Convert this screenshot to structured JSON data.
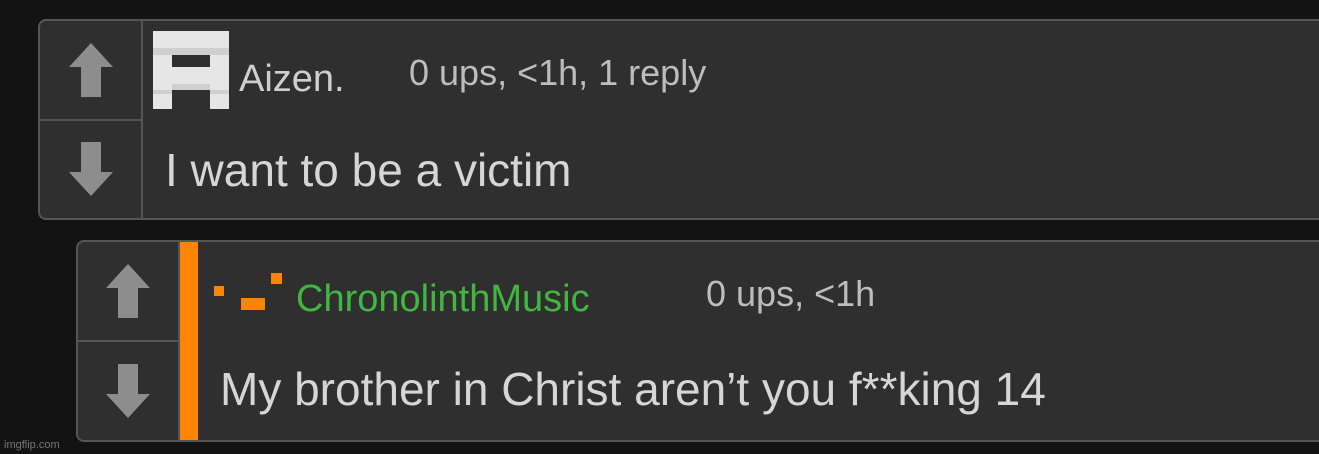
{
  "comments": [
    {
      "username": "Aizen.",
      "meta": "0 ups, <1h, 1 reply",
      "text": "I want to be a victim",
      "username_color": "#cfcfcf",
      "avatar": "white-pixel-avatar"
    },
    {
      "username": "ChronolinthMusic",
      "meta": "0 ups, <1h",
      "text": "My brother in Christ aren’t you f**king 14",
      "username_color": "#42b740",
      "avatar": "orange-pixel-avatar",
      "highlight_color": "#ff8400"
    }
  ],
  "icons": {
    "upvote": "upvote-arrow-icon",
    "downvote": "downvote-arrow-icon"
  },
  "colors": {
    "background": "#131313",
    "panel": "#2f2f2f",
    "border": "#555555",
    "arrow": "#8d8d8d"
  },
  "watermark": "imgflip.com"
}
